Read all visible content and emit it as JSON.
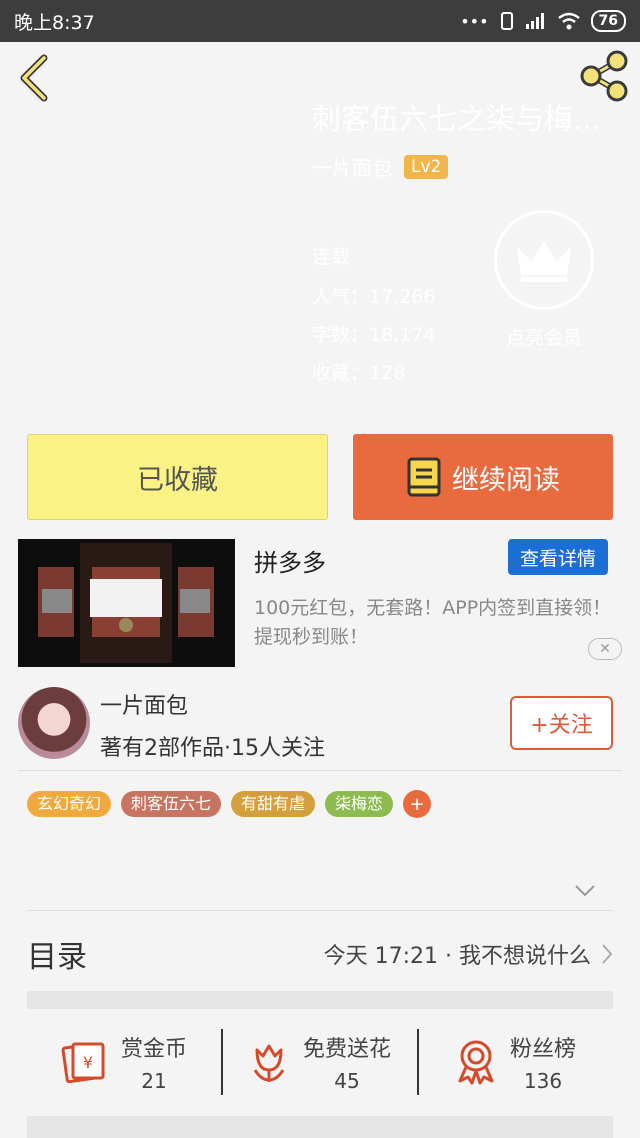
{
  "status_bar": {
    "time": "晚上8:37",
    "signal_text": "•••",
    "battery": "76"
  },
  "book": {
    "title": "刺客伍六七之柒与梅...",
    "author": "一片面包",
    "level": "Lv2",
    "status": "连载",
    "popularity": "人气：17,266",
    "word_count": "字数：18,174",
    "collections": "收藏：128",
    "vip_label": "点亮会员"
  },
  "actions": {
    "collected_label": "已收藏",
    "continue_label": "继续阅读"
  },
  "ad": {
    "title": "拼多多",
    "detail_button": "查看详情",
    "description": "100元红包，无套路！APP内签到直接领！提现秒到账！",
    "close_icon_text": "✕"
  },
  "author_block": {
    "name": "一片面包",
    "stats": "著有2部作品·15人关注",
    "follow_button": "+关注"
  },
  "tags": [
    {
      "label": "玄幻奇幻",
      "color": "#f0a93c"
    },
    {
      "label": "刺客伍六七",
      "color": "#c77460"
    },
    {
      "label": "有甜有虐",
      "color": "#d4a03e"
    },
    {
      "label": "柒梅恋",
      "color": "#8dbb4f"
    }
  ],
  "tag_add": "+",
  "toc": {
    "title": "目录",
    "latest": "今天 17:21 · 我不想说什么"
  },
  "stats": [
    {
      "label": "赏金币",
      "value": "21",
      "icon": "reward-coin-icon"
    },
    {
      "label": "免费送花",
      "value": "45",
      "icon": "flower-icon"
    },
    {
      "label": "粉丝榜",
      "value": "136",
      "icon": "fan-ranking-medal-icon"
    }
  ],
  "colors": {
    "accent": "#e86a3f",
    "collect_bg": "#fbf285",
    "ad_button": "#1a6fd6"
  }
}
